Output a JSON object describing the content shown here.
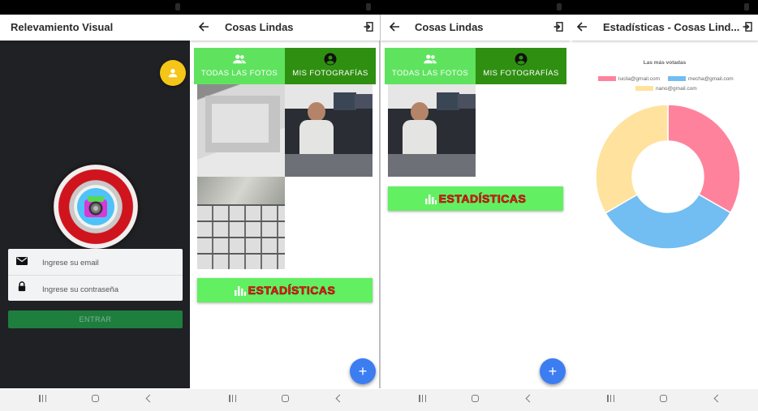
{
  "screens": {
    "login": {
      "title": "Relevamiento Visual",
      "email_placeholder": "Ingrese su email",
      "password_placeholder": "Ingrese su contraseña",
      "enter_label": "ENTRAR"
    },
    "all_photos": {
      "title": "Cosas Lindas",
      "tabs": [
        {
          "label": "TODAS LAS FOTOS",
          "icon": "group-icon"
        },
        {
          "label": "MIS FOTOGRAFÍAS",
          "icon": "account-circle-icon"
        }
      ],
      "stats_label": "ESTADÍSTICAS",
      "fab_label": "+"
    },
    "my_photos": {
      "title": "Cosas Lindas",
      "tabs": [
        {
          "label": "TODAS LAS FOTOS",
          "icon": "group-icon"
        },
        {
          "label": "MIS FOTOGRAFÍAS",
          "icon": "account-circle-icon"
        }
      ],
      "stats_label": "ESTADÍSTICAS",
      "fab_label": "+"
    },
    "stats": {
      "title": "Estadísticas - Cosas Lind...",
      "chart_data": {
        "type": "pie",
        "title": "Las más votadas",
        "categories": [
          "lucila@gmail.com",
          "mecha@gmail.com",
          "nano@gmail.com"
        ],
        "values": [
          33.3,
          33.3,
          33.4
        ],
        "colors": [
          "#ff829d",
          "#72bdf2",
          "#ffe29e"
        ],
        "legend": "top"
      }
    }
  },
  "colors": {
    "login_bg": "#202124",
    "tab_inactive": "#5fe35f",
    "tab_active": "#2f8f11",
    "stats_button": "#62f062",
    "stats_text": "#ff1a1a",
    "fab": "#3d7df2",
    "avatar": "#f5c518"
  }
}
